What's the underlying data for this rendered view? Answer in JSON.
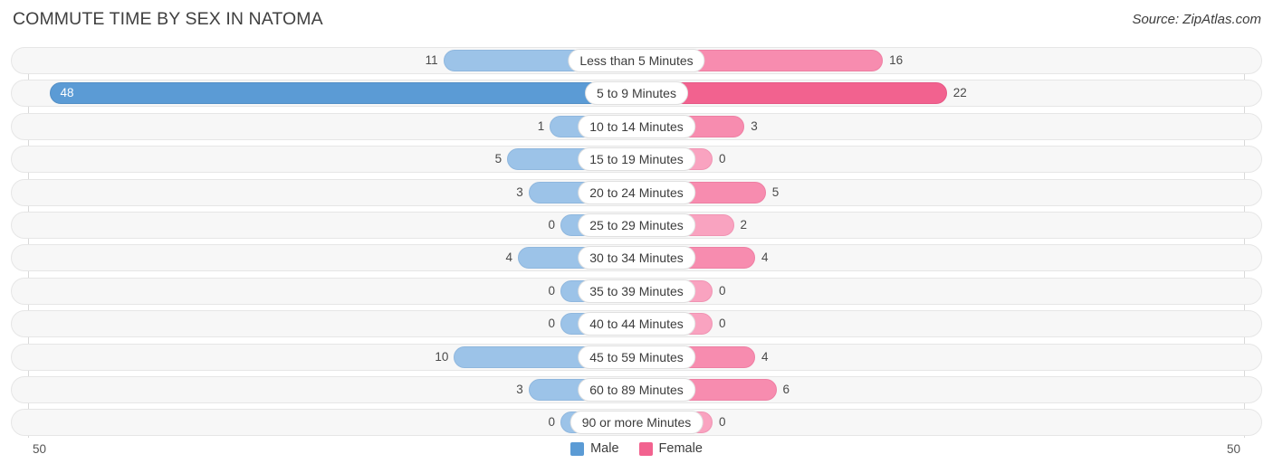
{
  "header": {
    "title": "COMMUTE TIME BY SEX IN NATOMA",
    "source": "Source: ZipAtlas.com"
  },
  "axis": {
    "left_label": "50",
    "right_label": "50"
  },
  "legend": {
    "items": [
      {
        "label": "Male",
        "color": "#5b9bd5"
      },
      {
        "label": "Female",
        "color": "#f2628f"
      }
    ]
  },
  "chart_data": {
    "type": "bar",
    "subtype": "diverging-bidirectional",
    "title": "COMMUTE TIME BY SEX IN NATOMA",
    "source": "Source: ZipAtlas.com",
    "xlabel": "",
    "ylabel": "",
    "xlim": [
      50,
      50
    ],
    "axis_max": 50,
    "grid": false,
    "legend_position": "bottom-center",
    "categories": [
      "Less than 5 Minutes",
      "5 to 9 Minutes",
      "10 to 14 Minutes",
      "15 to 19 Minutes",
      "20 to 24 Minutes",
      "25 to 29 Minutes",
      "30 to 34 Minutes",
      "35 to 39 Minutes",
      "40 to 44 Minutes",
      "45 to 59 Minutes",
      "60 to 89 Minutes",
      "90 or more Minutes"
    ],
    "series": [
      {
        "name": "Male",
        "direction": "left",
        "color": "#9cc3e8",
        "values": [
          11,
          48,
          1,
          5,
          3,
          0,
          4,
          0,
          0,
          10,
          3,
          0
        ]
      },
      {
        "name": "Female",
        "direction": "right",
        "color": "#f9a3c0",
        "values": [
          16,
          22,
          3,
          0,
          5,
          2,
          4,
          0,
          0,
          4,
          6,
          0
        ]
      }
    ]
  },
  "rows": [
    {
      "category": "Less than 5 Minutes",
      "male": "11",
      "female": "16"
    },
    {
      "category": "5 to 9 Minutes",
      "male": "48",
      "female": "22"
    },
    {
      "category": "10 to 14 Minutes",
      "male": "1",
      "female": "3"
    },
    {
      "category": "15 to 19 Minutes",
      "male": "5",
      "female": "0"
    },
    {
      "category": "20 to 24 Minutes",
      "male": "3",
      "female": "5"
    },
    {
      "category": "25 to 29 Minutes",
      "male": "0",
      "female": "2"
    },
    {
      "category": "30 to 34 Minutes",
      "male": "4",
      "female": "4"
    },
    {
      "category": "35 to 39 Minutes",
      "male": "0",
      "female": "0"
    },
    {
      "category": "40 to 44 Minutes",
      "male": "0",
      "female": "0"
    },
    {
      "category": "45 to 59 Minutes",
      "male": "10",
      "female": "4"
    },
    {
      "category": "60 to 89 Minutes",
      "male": "3",
      "female": "6"
    },
    {
      "category": "90 or more Minutes",
      "male": "0",
      "female": "0"
    }
  ]
}
